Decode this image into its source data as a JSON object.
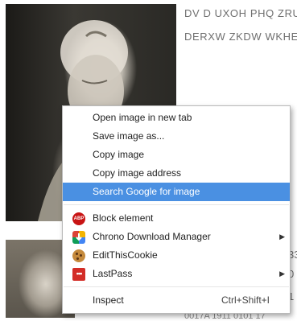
{
  "page": {
    "text_lines": [
      "DV D UXOH PHQ ZRU",
      "DERXW ZKDW WKHE"
    ],
    "side_numbers": [
      "33",
      "0",
      "1"
    ],
    "bottom_fragment": "0017A   1911 0101 17"
  },
  "context_menu": {
    "items": [
      {
        "label": "Open image in new tab"
      },
      {
        "label": "Save image as..."
      },
      {
        "label": "Copy image"
      },
      {
        "label": "Copy image address"
      },
      {
        "label": "Search Google for image"
      },
      {
        "label": "Block element",
        "icon": "adblock-plus-icon",
        "icon_text": "ABP"
      },
      {
        "label": "Chrono Download Manager",
        "icon": "chrono-download-icon"
      },
      {
        "label": "EditThisCookie",
        "icon": "cookie-icon"
      },
      {
        "label": "LastPass",
        "icon": "lastpass-icon",
        "icon_text": "•••"
      },
      {
        "label": "Inspect",
        "shortcut": "Ctrl+Shift+I"
      }
    ],
    "highlight_color": "#4a90e2"
  }
}
